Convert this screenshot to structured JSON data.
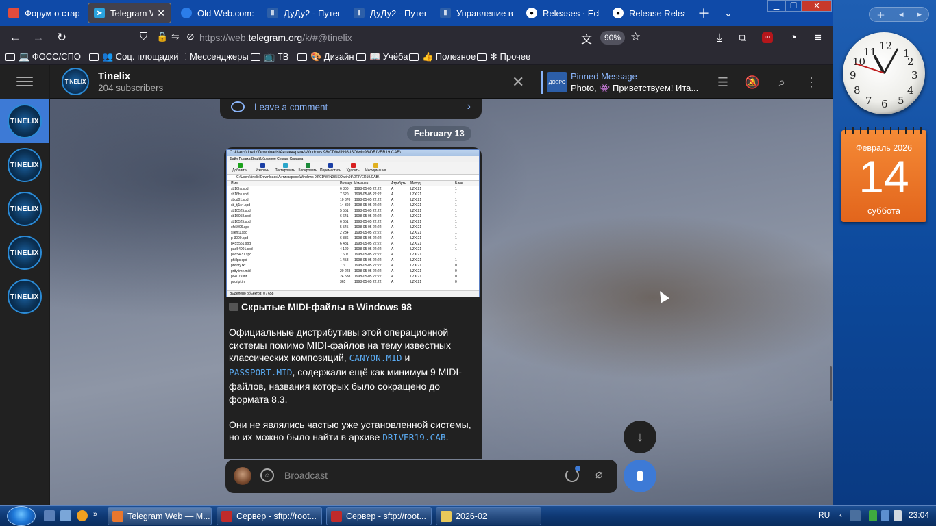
{
  "browser": {
    "tabs": [
      {
        "label": "Форум о старо",
        "icon_color": "#e24c3c",
        "active": false
      },
      {
        "label": "Telegram Web",
        "icon_color": "#2aa3df",
        "active": true
      },
      {
        "label": "Old-Web.com: ",
        "icon_color": "#2b7de9",
        "active": false
      },
      {
        "label": "ДуДу2 - Путево",
        "icon_color": "#2d5fa8",
        "active": false
      },
      {
        "label": "ДуДу2 - Путев",
        "icon_color": "#2d5fa8",
        "active": false
      },
      {
        "label": "Управление вл",
        "icon_color": "#2d5fa8",
        "active": false
      },
      {
        "label": "Releases · Eclips",
        "icon_color": "#ffffff",
        "active": false
      },
      {
        "label": "Release Release",
        "icon_color": "#ffffff",
        "active": false
      }
    ],
    "url_prefix": "https://web.",
    "url_domain": "telegram.org",
    "url_suffix": "/k/#@tinelix",
    "zoom": "90%",
    "bookmarks": [
      {
        "label": "💻 ФОСС/СПО"
      },
      {
        "label": "👥 Соц. площадки"
      },
      {
        "label": "Мессенджеры"
      },
      {
        "label": "📺 ТВ"
      },
      {
        "label": "🎨 Дизайн"
      },
      {
        "label": "📖 Учёба"
      },
      {
        "label": "👍 Полезное"
      },
      {
        "label": "❇ Прочее"
      }
    ]
  },
  "telegram": {
    "sidebar_avatars": [
      "TINELIX",
      "TINELIX",
      "TINELIX",
      "TINELIX",
      "TINELIX"
    ],
    "channel": {
      "avatar_text": "TINELIX",
      "title": "Tinelix",
      "subscribers": "204 subscribers"
    },
    "pinned": {
      "title": "Pinned Message",
      "text": "Photo, 👾 Приветствуем! Ита...",
      "thumb_text": "ДОБРО"
    },
    "previous_message": {
      "comment_label": "Leave a comment"
    },
    "date_chip": "February 13",
    "message": {
      "screenshot": {
        "title": "C:\\Users\\tinelix\\Downloads\\Антикварное\\Windows 98\\CD\\WIN98\\ISO\\win98\\DRIVER19.CAB\\",
        "menu": "Файл   Правка   Вид   Избранное   Сервис   Справка",
        "tools": [
          {
            "label": "Добавить",
            "color": "#1ca21c"
          },
          {
            "label": "Извлечь",
            "color": "#1b3fa5"
          },
          {
            "label": "Тестировать",
            "color": "#2aa5c9"
          },
          {
            "label": "Копировать",
            "color": "#1b8a3a"
          },
          {
            "label": "Переместить",
            "color": "#1b3fa5"
          },
          {
            "label": "Удалить",
            "color": "#d82020"
          },
          {
            "label": "Информация",
            "color": "#e0b020"
          }
        ],
        "address": "C:\\Users\\tinelix\\Downloads\\Антикварное\\Windows 98\\CD\\WIN98\\ISO\\win98\\DRIVER19.CAB\\",
        "columns": [
          "Имя",
          "Размер",
          "Изменен",
          "Атрибуты",
          "Метод",
          "Блок"
        ],
        "rows": [
          [
            "sb16hs.spd",
            "6 800",
            "1998-05-05 22:22",
            "A",
            "LZX:21",
            "1"
          ],
          [
            "sb16hs.spd",
            "7 620",
            "1998-05-05 22:22",
            "A",
            "LZX:21",
            "1"
          ],
          [
            "sbcd01.spd",
            "10 370",
            "1998-05-05 22:22",
            "A",
            "LZX:21",
            "1"
          ],
          [
            "sb_tj1s4.spd",
            "14 360",
            "1998-05-05 22:22",
            "A",
            "LZX:21",
            "1"
          ],
          [
            "sb10525.spd",
            "5 551",
            "1998-05-05 22:22",
            "A",
            "LZX:21",
            "1"
          ],
          [
            "sb16058.spd",
            "6 641",
            "1998-05-05 22:22",
            "A",
            "LZX:21",
            "1"
          ],
          [
            "sb16525.spd",
            "6 651",
            "1998-05-05 22:22",
            "A",
            "LZX:21",
            "1"
          ],
          [
            "sfs5006.spd",
            "5 545",
            "1998-05-05 22:22",
            "A",
            "LZX:21",
            "1"
          ],
          [
            "silent1.spd",
            "2 234",
            "1998-05-05 22:22",
            "A",
            "LZX:21",
            "1"
          ],
          [
            "p-3000.spd",
            "6 386",
            "1998-05-05 22:22",
            "A",
            "LZX:21",
            "1"
          ],
          [
            "p455551.spd",
            "6 481",
            "1998-05-05 22:22",
            "A",
            "LZX:21",
            "1"
          ],
          [
            "paq54001.spd",
            "4 129",
            "1998-05-05 22:22",
            "A",
            "LZX:21",
            "1"
          ],
          [
            "paq54i31.spd",
            "7 607",
            "1998-05-05 22:22",
            "A",
            "LZX:21",
            "1"
          ],
          [
            "phillps.spd",
            "1 458",
            "1998-05-05 22:22",
            "A",
            "LZX:21",
            "1"
          ],
          [
            "priority.txt",
            "719",
            "1998-05-05 22:22",
            "A",
            "LZX:21",
            "0"
          ],
          [
            "prttytime.mid",
            "20 223",
            "1998-05-05 22:22",
            "A",
            "LZX:21",
            "0"
          ],
          [
            "ps4079.inf",
            "24 588",
            "1998-05-05 22:22",
            "A",
            "LZX:21",
            "0"
          ],
          [
            "pscript.ini",
            "365",
            "1998-05-05 22:22",
            "A",
            "LZX:21",
            "0"
          ]
        ],
        "status": "Выделено объектов: 0 / 658"
      },
      "title": "Скрытые MIDI-файлы в Windows 98",
      "p1_a": "Официальные дистрибутивы этой операционной системы помимо MIDI-файлов на тему известных классических композиций, ",
      "code1": "CANYON.MID",
      "p1_b": " и ",
      "code2": "PASSPORT.MID",
      "p1_c": ", содержали ещё как минимум 9 MIDI-файлов, названия которых было сокращено до формата 8.3.",
      "p2_a": "Они не являлись частью уже установленной системы, но их можно было найти в архиве ",
      "code3": "DRIVER19.CAB",
      "p2_b": "."
    },
    "composer": {
      "placeholder": "Broadcast"
    }
  },
  "gadgets": {
    "clock": {
      "hour": 11,
      "minute": 4,
      "second": 48
    },
    "calendar": {
      "month": "Февраль 2026",
      "day": "14",
      "weekday": "суббота"
    }
  },
  "taskbar": {
    "tasks": [
      {
        "label": "Telegram Web — M...",
        "color": "#e8772e",
        "active": true
      },
      {
        "label": "Сервер - sftp://root...",
        "color": "#bf2b2b",
        "active": false
      },
      {
        "label": "Сервер - sftp://root...",
        "color": "#bf2b2b",
        "active": false
      },
      {
        "label": "2026-02",
        "color": "#e8c85a",
        "active": false
      }
    ],
    "lang": "RU",
    "time": "23:04"
  }
}
